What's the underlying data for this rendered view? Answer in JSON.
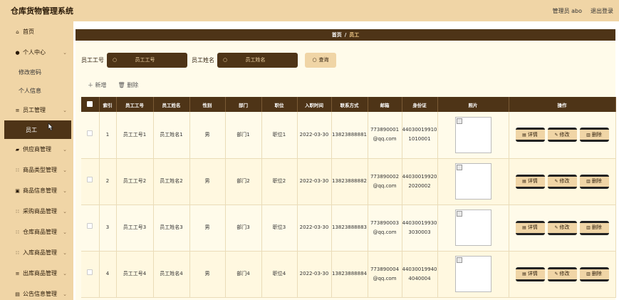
{
  "app": {
    "title": "仓库货物管理系统",
    "user_label": "管理员 abo",
    "logout_label": "退出登录"
  },
  "sidebar": {
    "items": [
      {
        "label": "首页",
        "icon": "home-icon"
      },
      {
        "label": "个人中心",
        "icon": "user-icon"
      },
      {
        "label": "修改密码",
        "sub": true
      },
      {
        "label": "个人信息",
        "sub": true
      },
      {
        "label": "员工管理",
        "icon": "list-icon"
      },
      {
        "label": "员工",
        "sub": true,
        "active": true
      },
      {
        "label": "供应商管理",
        "icon": "truck-icon"
      },
      {
        "label": "商品类型管理",
        "icon": "grid-icon"
      },
      {
        "label": "商品信息管理",
        "icon": "box-icon"
      },
      {
        "label": "采购商品管理",
        "icon": "grid-icon"
      },
      {
        "label": "仓库商品管理",
        "icon": "grid-icon"
      },
      {
        "label": "入库商品管理",
        "icon": "grid-icon"
      },
      {
        "label": "出库商品管理",
        "icon": "list-icon"
      },
      {
        "label": "公告信息管理",
        "icon": "doc-icon"
      }
    ]
  },
  "breadcrumb": {
    "home": "首页",
    "sep": "/",
    "current": "员工"
  },
  "search": {
    "field1_label": "员工工号",
    "field1_placeholder": "员工工号",
    "field2_label": "员工姓名",
    "field2_placeholder": "员工姓名",
    "button_label": "查询"
  },
  "toolbar": {
    "add_label": "新增",
    "delete_label": "删除"
  },
  "table": {
    "columns": [
      "索引",
      "员工工号",
      "员工姓名",
      "性别",
      "部门",
      "职位",
      "入职时间",
      "联系方式",
      "邮箱",
      "身份证",
      "照片",
      "操作"
    ],
    "rows": [
      {
        "index": "1",
        "emp_no": "员工工号1",
        "name": "员工姓名1",
        "gender": "男",
        "dept": "部门1",
        "position": "职位1",
        "hire_date": "2022-03-30",
        "phone": "13823888881",
        "email": "773890001@qq.com",
        "id_card": "440300199101010001"
      },
      {
        "index": "2",
        "emp_no": "员工工号2",
        "name": "员工姓名2",
        "gender": "男",
        "dept": "部门2",
        "position": "职位2",
        "hire_date": "2022-03-30",
        "phone": "13823888882",
        "email": "773890002@qq.com",
        "id_card": "440300199202020002"
      },
      {
        "index": "3",
        "emp_no": "员工工号3",
        "name": "员工姓名3",
        "gender": "男",
        "dept": "部门3",
        "position": "职位3",
        "hire_date": "2022-03-30",
        "phone": "13823888883",
        "email": "773890003@qq.com",
        "id_card": "440300199303030003"
      },
      {
        "index": "4",
        "emp_no": "员工工号4",
        "name": "员工姓名4",
        "gender": "男",
        "dept": "部门4",
        "position": "职位4",
        "hire_date": "2022-03-30",
        "phone": "13823888884",
        "email": "773890004@qq.com",
        "id_card": "440300199404040004"
      }
    ],
    "op_labels": {
      "detail": "详情",
      "edit": "修改",
      "delete": "删除"
    }
  }
}
